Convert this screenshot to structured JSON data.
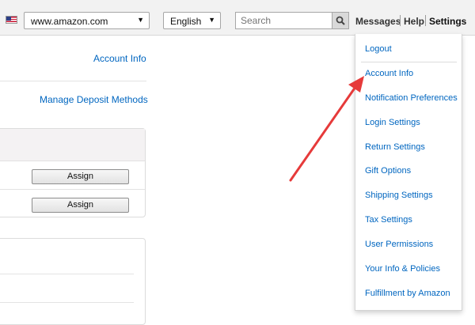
{
  "topbar": {
    "flag_icon": "us-flag-icon",
    "marketplace": "www.amazon.com",
    "language": "English",
    "search_placeholder": "Search",
    "messages": "Messages",
    "help": "Help",
    "settings": "Settings"
  },
  "main": {
    "account_info": "Account Info",
    "manage_deposit": "Manage Deposit Methods",
    "assign_1": "Assign",
    "assign_2": "Assign"
  },
  "settings_menu": {
    "items": [
      "Logout",
      "Account Info",
      "Notification Preferences",
      "Login Settings",
      "Return Settings",
      "Gift Options",
      "Shipping Settings",
      "Tax Settings",
      "User Permissions",
      "Your Info & Policies",
      "Fulfillment by Amazon"
    ]
  },
  "annotation": {
    "color": "#e63a3a"
  },
  "colors": {
    "link": "#0066c0",
    "topbar_bg": "#f2f2f2"
  }
}
